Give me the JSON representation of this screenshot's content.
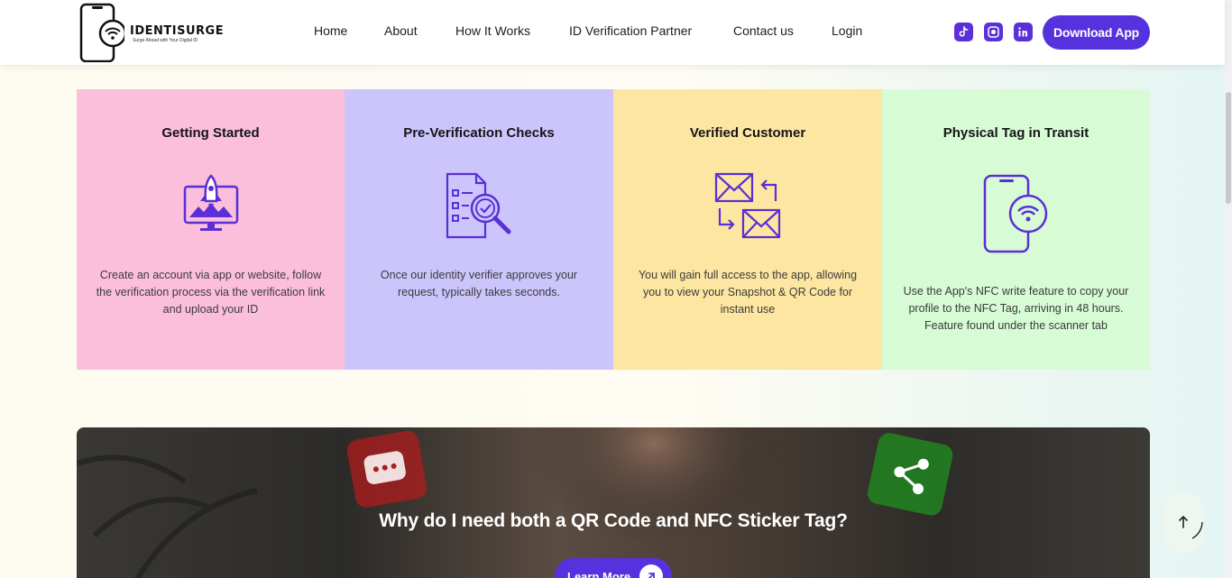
{
  "brand": {
    "name": "IDENTISURGE",
    "tagline": "Surge Ahead with Your Digital ID"
  },
  "nav": [
    {
      "label": "Home"
    },
    {
      "label": "About"
    },
    {
      "label": "How It Works"
    },
    {
      "label": "ID Verification Partner"
    },
    {
      "label": "Contact us"
    },
    {
      "label": "Login"
    }
  ],
  "social": [
    {
      "icon": "tiktok-icon"
    },
    {
      "icon": "instagram-icon"
    },
    {
      "icon": "linkedin-icon"
    }
  ],
  "download_label": "Download App",
  "colors": {
    "accent": "#5532de",
    "card_pink": "#fbbfdc",
    "card_lavender": "#cbc5fc",
    "card_yellow": "#fde6a1",
    "card_mint": "#d7fbd4"
  },
  "steps": [
    {
      "title": "Getting Started",
      "icon": "rocket-monitor-icon",
      "description": "Create an account via app or website, follow the verification process via the verification link and upload your ID"
    },
    {
      "title": "Pre-Verification Checks",
      "icon": "document-search-icon",
      "description": "Once our identity verifier approves your request, typically takes seconds."
    },
    {
      "title": "Verified Customer",
      "icon": "mail-exchange-icon",
      "description": "You will gain full access to the app, allowing you to view your Snapshot & QR Code for instant use"
    },
    {
      "title": "Physical Tag in Transit",
      "icon": "phone-nfc-icon",
      "description": "Use the App's NFC write feature to copy your profile to the NFC Tag, arriving in 48 hours. Feature found under the scanner tab"
    }
  ],
  "banner": {
    "title": "Why do I need both a QR Code and NFC Sticker Tag?",
    "button_label": "Learn More"
  }
}
